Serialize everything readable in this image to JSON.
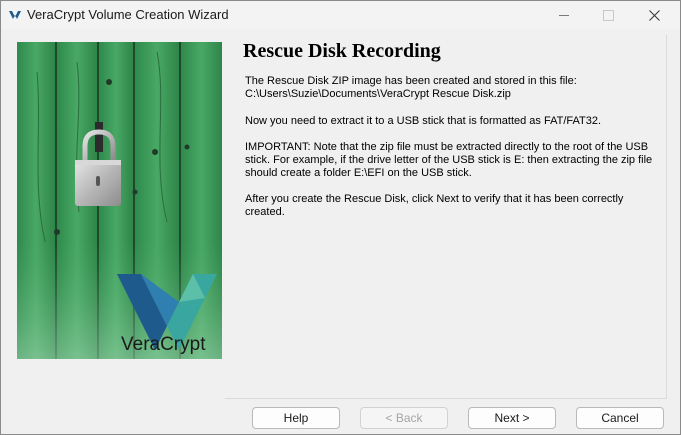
{
  "window": {
    "title": "VeraCrypt Volume Creation Wizard"
  },
  "side_panel": {
    "logo_text": "VeraCrypt",
    "image_description_icon": "padlock-on-green-door"
  },
  "content": {
    "heading": "Rescue Disk Recording",
    "paragraph1": "The Rescue Disk ZIP image has been created and stored in this file:\nC:\\Users\\Suzie\\Documents\\VeraCrypt Rescue Disk.zip",
    "paragraph2": "Now you need to extract it to a USB stick that is formatted as FAT/FAT32.",
    "paragraph3": "IMPORTANT: Note that the zip file must be extracted directly to the root of the USB stick. For example, if the drive letter of the USB stick is E: then extracting the zip file should create a folder E:\\EFI on the USB stick.",
    "paragraph4": "After you create the Rescue Disk, click Next to verify that it has been correctly created."
  },
  "buttons": {
    "help": "Help",
    "back": "< Back",
    "next": "Next >",
    "cancel": "Cancel"
  },
  "colors": {
    "window_bg": "#f0f0f0",
    "door_green": "#3e9a5a",
    "logo_blue": "#1e5a8c",
    "logo_teal": "#3aa6a0"
  }
}
